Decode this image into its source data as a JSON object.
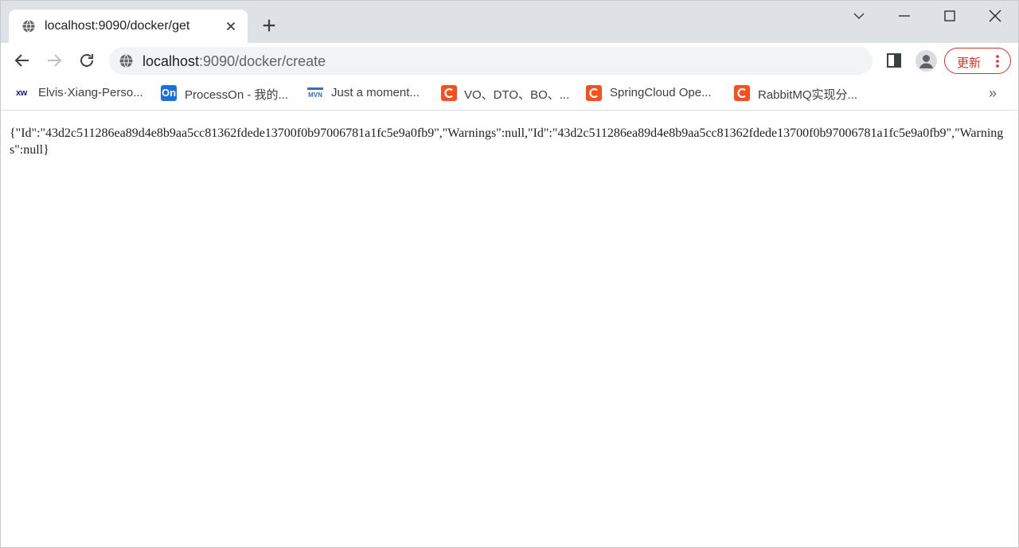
{
  "tab": {
    "title": "localhost:9090/docker/get",
    "icon": "globe-icon"
  },
  "toolbar": {
    "url_host": "localhost",
    "url_rest": ":9090/docker/create",
    "update_label": "更新"
  },
  "bookmarks": [
    {
      "label": "Elvis·Xiang-Perso...",
      "favicon": "xw"
    },
    {
      "label": "ProcessOn - 我的...",
      "favicon": "On"
    },
    {
      "label": "Just a moment...",
      "favicon": "MVN"
    },
    {
      "label": "VO、DTO、BO、...",
      "favicon": "csdn"
    },
    {
      "label": "SpringCloud Ope...",
      "favicon": "csdn"
    },
    {
      "label": "RabbitMQ实现分...",
      "favicon": "csdn"
    }
  ],
  "bookmarks_more": "»",
  "page": {
    "body_text": "{\"Id\":\"43d2c511286ea89d4e8b9aa5cc81362fdede13700f0b97006781a1fc5e9a0fb9\",\"Warnings\":null,\"Id\":\"43d2c511286ea89d4e8b9aa5cc81362fdede13700f0b97006781a1fc5e9a0fb9\",\"Warnings\":null}"
  },
  "colors": {
    "tabstrip": "#dee1e6",
    "omnibox": "#f1f3f4",
    "update_accent": "#d93025",
    "csdn_favicon": "#f4511e"
  }
}
